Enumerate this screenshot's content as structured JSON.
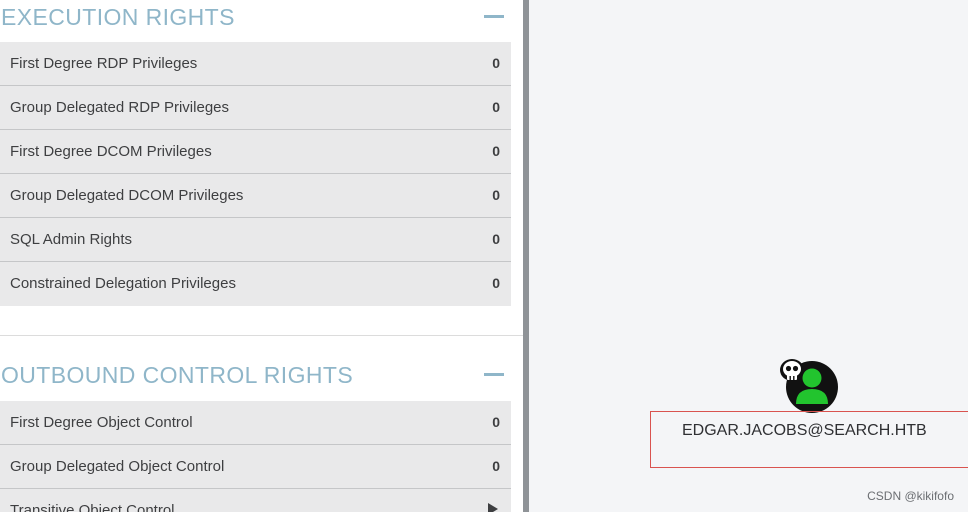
{
  "execution_rights": {
    "title": "EXECUTION RIGHTS",
    "rows": [
      {
        "label": "First Degree RDP Privileges",
        "count": "0"
      },
      {
        "label": "Group Delegated RDP Privileges",
        "count": "0"
      },
      {
        "label": "First Degree DCOM Privileges",
        "count": "0"
      },
      {
        "label": "Group Delegated DCOM Privileges",
        "count": "0"
      },
      {
        "label": "SQL Admin Rights",
        "count": "0"
      },
      {
        "label": "Constrained Delegation Privileges",
        "count": "0"
      }
    ]
  },
  "outbound_control_rights": {
    "title": "OUTBOUND CONTROL RIGHTS",
    "rows": [
      {
        "label": "First Degree Object Control",
        "count": "0"
      },
      {
        "label": "Group Delegated Object Control",
        "count": "0"
      },
      {
        "label": "Transitive Object Control",
        "count": ""
      }
    ]
  },
  "graph": {
    "node_label": "EDGAR.JACOBS@SEARCH.HTB",
    "node_icon": "user-skull-icon",
    "node_color": "#22c42e",
    "highlight_color": "#d9534f"
  },
  "watermark": "CSDN @kikifofo"
}
